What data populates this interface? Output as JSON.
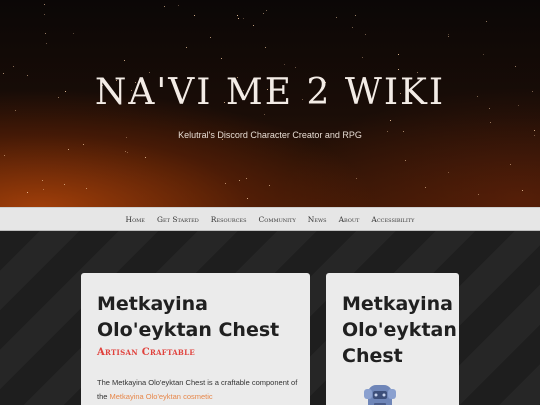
{
  "header": {
    "title": "NA'VI ME 2 WIKI",
    "subtitle": "Kelutral's Discord Character Creator and RPG"
  },
  "nav": {
    "items": [
      "Home",
      "Get Started",
      "Resources",
      "Community",
      "News",
      "About",
      "Accessibility"
    ]
  },
  "main_card": {
    "title": "Metkayina Olo'eyktan Chest",
    "tag": "Artisan Craftable",
    "body_start": "The Metkayina Olo'eyktan Chest is a craftable component of the ",
    "body_link": "Metkayina Olo'eyktan cosmetic"
  },
  "side_card": {
    "title": "Metkayina Olo'eyktan Chest",
    "image_icon": "chest-armor-icon"
  },
  "colors": {
    "accent_red": "#e0413c",
    "link_orange": "#e7874a",
    "nav_bg": "#e6e6e6"
  }
}
